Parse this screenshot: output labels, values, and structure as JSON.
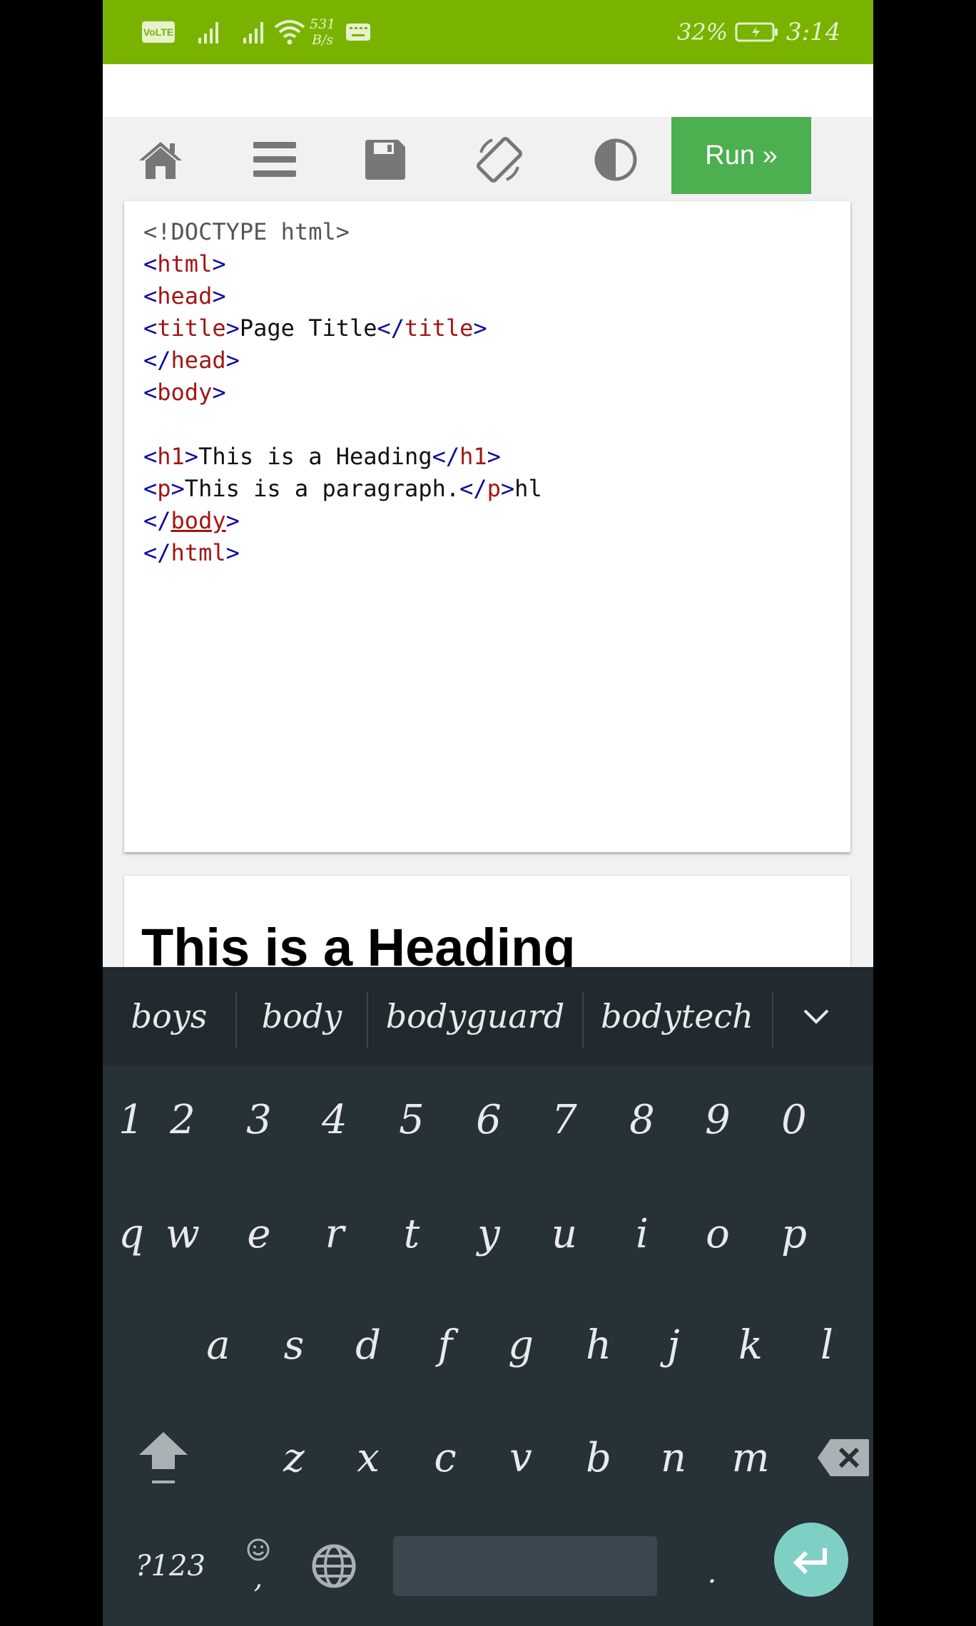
{
  "status_bar": {
    "volte": "VoLTE",
    "net_speed_value": "531",
    "net_speed_unit": "B/s",
    "battery": "32%",
    "time": "3:14",
    "background": "#7ab200",
    "icons": [
      "signal-icon",
      "signal-icon",
      "wifi-icon",
      "keyboard-icon",
      "battery-icon"
    ]
  },
  "toolbar": {
    "run_label": "Run »",
    "run_color": "#4caf50",
    "icons": [
      "home-icon",
      "menu-icon",
      "save-icon",
      "rotate-icon",
      "contrast-icon"
    ]
  },
  "editor": {
    "lines": [
      "<!DOCTYPE html>",
      "<html>",
      "<head>",
      "<title>Page Title</title>",
      "</head>",
      "<body>",
      "",
      "<h1>This is a Heading</h1>",
      "<p>This is a paragraph.</p>hl",
      "</body>",
      "</html>"
    ]
  },
  "result": {
    "heading": "This is a Heading"
  },
  "keyboard": {
    "suggestions": [
      "boys",
      "body",
      "bodyguard",
      "bodytech"
    ],
    "number_row": [
      "1",
      "2",
      "3",
      "4",
      "5",
      "6",
      "7",
      "8",
      "9",
      "0"
    ],
    "row1": [
      "q",
      "w",
      "e",
      "r",
      "t",
      "y",
      "u",
      "i",
      "o",
      "p"
    ],
    "row2": [
      "a",
      "s",
      "d",
      "f",
      "g",
      "h",
      "j",
      "k",
      "l"
    ],
    "row3": [
      "z",
      "x",
      "c",
      "v",
      "b",
      "n",
      "m"
    ],
    "symbols_label": "?123",
    "comma_label": ",",
    "period_label": ".",
    "icons": [
      "shift-icon",
      "backspace-icon",
      "emoji-icon",
      "globe-icon",
      "enter-icon",
      "chevron-down-icon"
    ]
  }
}
